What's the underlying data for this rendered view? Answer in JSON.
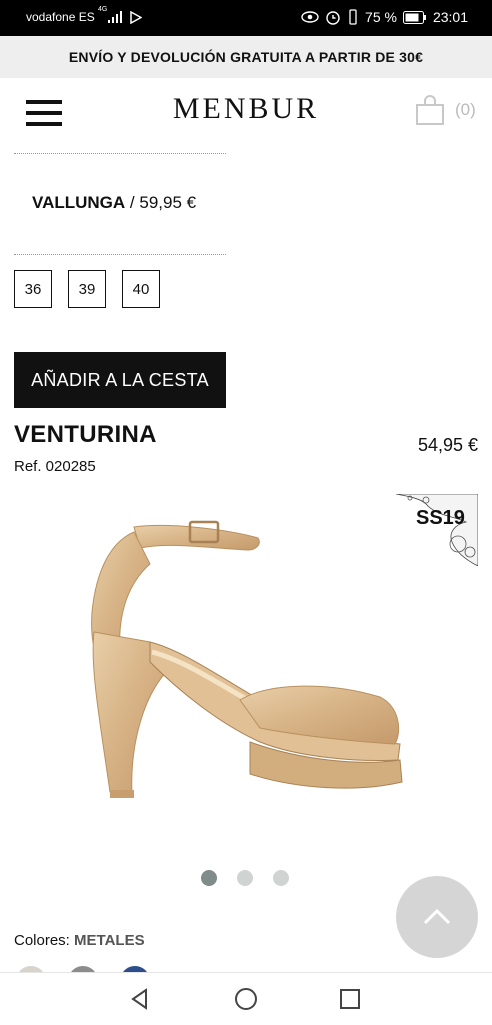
{
  "status_bar": {
    "carrier": "vodafone ES",
    "network": "4G",
    "battery": "75 %",
    "time": "23:01"
  },
  "promo_banner": {
    "text": "ENVÍO Y DEVOLUCIÓN GRATUITA A PARTIR DE 30€"
  },
  "header": {
    "logo": "MENBUR",
    "cart_count": "(0)"
  },
  "previous_product": {
    "name": "VALLUNGA",
    "separator": " / ",
    "price": "59,95 €"
  },
  "sizes": [
    "36",
    "39",
    "40"
  ],
  "add_to_cart": {
    "label": "AÑADIR A LA CESTA"
  },
  "product": {
    "name": "VENTURINA",
    "price": "54,95 €",
    "ref": "Ref. 020285",
    "badge": "SS19",
    "image_count": 3,
    "active_image": 1
  },
  "colors": {
    "label": "Colores: ",
    "value": "METALES",
    "swatches": [
      "#d8d4cc",
      "#8c8c8c",
      "#2c4f8c"
    ]
  },
  "colors_theme": {
    "primary": "#111111",
    "promo_bg": "#eeeeee",
    "dot_active": "#7f8c8a",
    "dot_inactive": "#cfd4d2"
  }
}
